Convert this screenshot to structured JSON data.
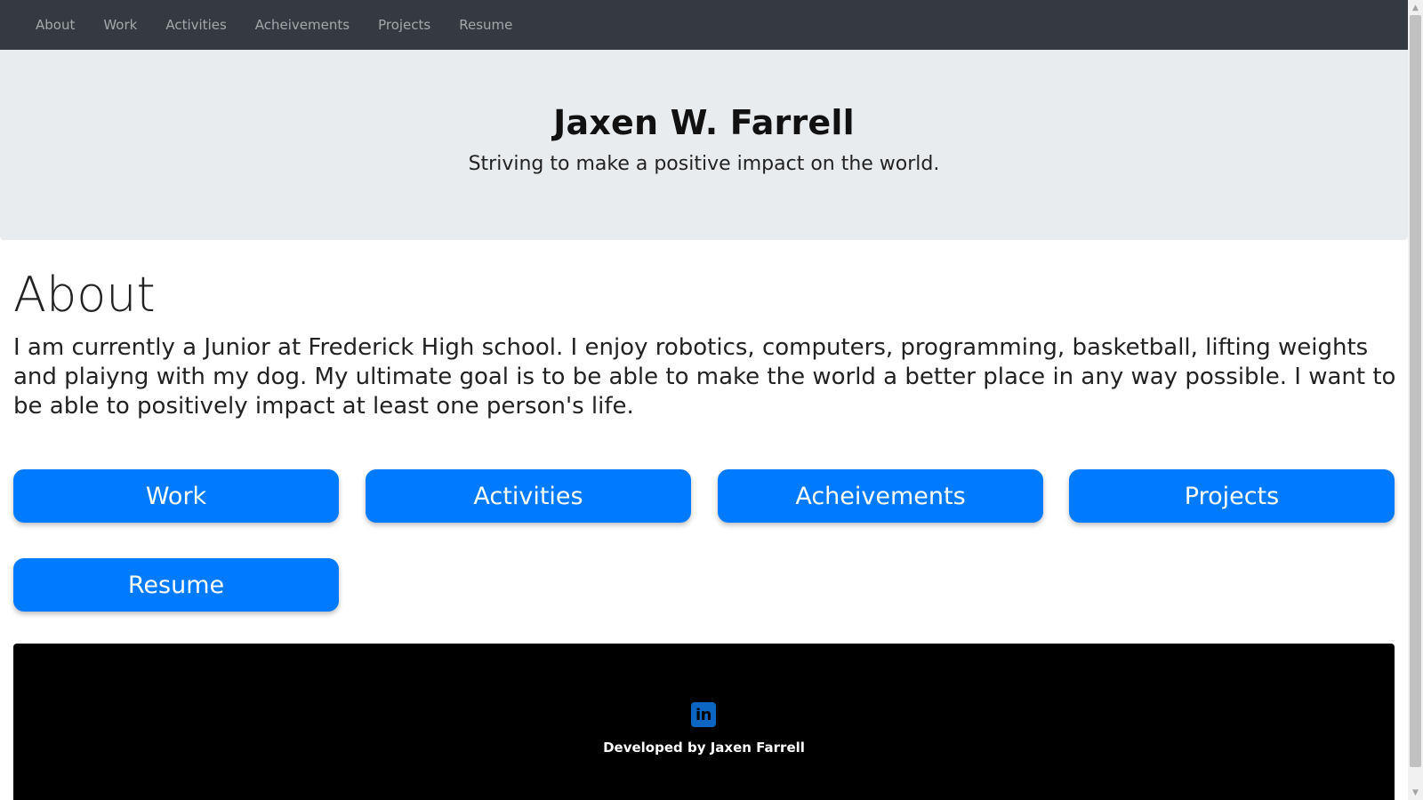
{
  "nav": {
    "items": [
      {
        "label": "About"
      },
      {
        "label": "Work"
      },
      {
        "label": "Activities"
      },
      {
        "label": "Acheivements"
      },
      {
        "label": "Projects"
      },
      {
        "label": "Resume"
      }
    ]
  },
  "hero": {
    "name": "Jaxen W. Farrell",
    "tagline": "Striving to make a positive impact on the world."
  },
  "about": {
    "heading": "About",
    "text": "I am currently a Junior at Frederick High school. I enjoy robotics, computers, programming, basketball, lifting weights and plaiyng with my dog. My ultimate goal is to be able to make the world a better place in any way possible. I want to be able to positively impact at least one person's life."
  },
  "buttons": [
    {
      "label": "Work"
    },
    {
      "label": "Activities"
    },
    {
      "label": "Acheivements"
    },
    {
      "label": "Projects"
    },
    {
      "label": "Resume"
    }
  ],
  "footer": {
    "icon": "linkedin-icon",
    "icon_glyph": "in",
    "credit": "Developed by Jaxen Farrell"
  },
  "colors": {
    "navbar": "#343a40",
    "jumbotron": "#e9ecef",
    "button": "#007bff",
    "footer": "#000000",
    "linkedin": "#0a66c2"
  }
}
